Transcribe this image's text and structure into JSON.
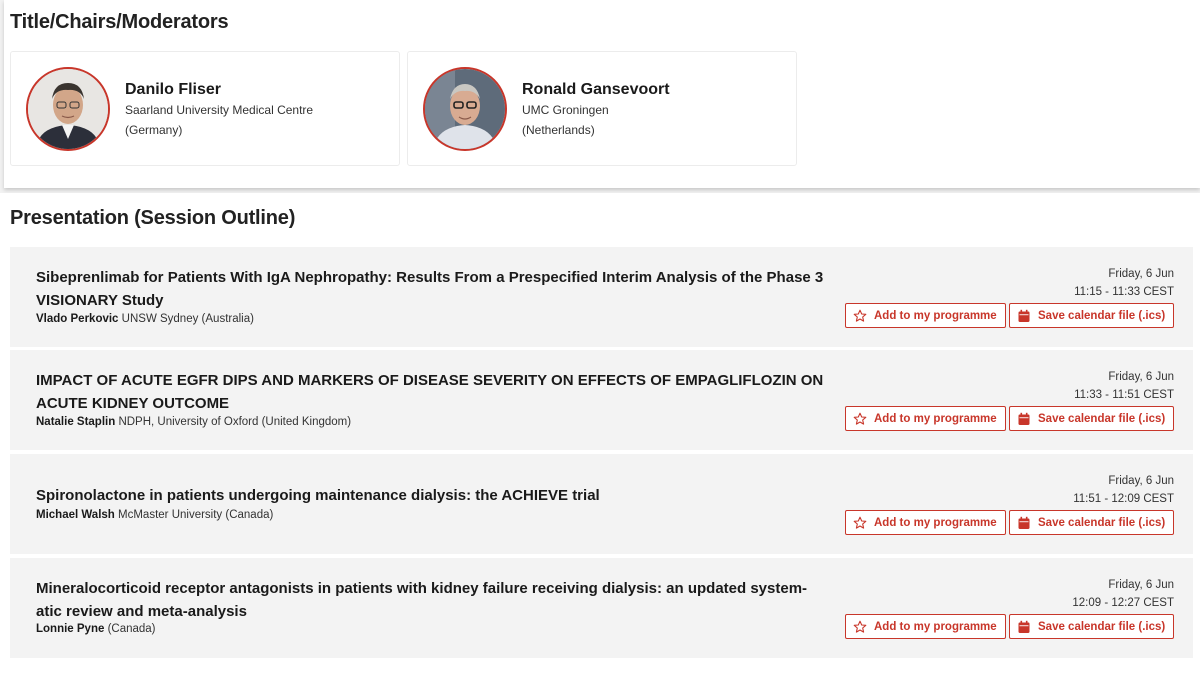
{
  "chairs_section": {
    "title": "Title/Chairs/Moderators",
    "chairs": [
      {
        "name": "Danilo Fliser",
        "org": "Saarland University Medical Centre",
        "country": "(Germany)"
      },
      {
        "name": "Ronald Gansevoort",
        "org": "UMC Groningen",
        "country": "(Netherlands)"
      }
    ]
  },
  "presentation_section": {
    "title": "Presentation (Session Outline)",
    "add_label": "Add to my programme",
    "ics_label": "Save calendar file (.ics)",
    "items": [
      {
        "title_line1": "Sibeprenlimab for Patients With IgA Nephropathy: Results From a Prespecified Interim Analysis of the Phase 3",
        "title_line2": "VISIONARY Study",
        "speaker": "Vlado Perkovic",
        "affiliation": " UNSW Sydney (Australia)",
        "date": "Friday, 6 Jun",
        "time": "11:15 - 11:33 CEST"
      },
      {
        "title_line1": "IMPACT OF ACUTE EGFR DIPS AND MARKERS OF DISEASE SEVERITY ON EFFECTS OF EMPAGLIFLOZIN ON",
        "title_line2": "ACUTE KIDNEY OUTCOME",
        "speaker": "Natalie Staplin",
        "affiliation": " NDPH, University of Oxford (United Kingdom)",
        "date": "Friday, 6 Jun",
        "time": "11:33 - 11:51 CEST"
      },
      {
        "title_line1": "Spironolactone in patients undergoing maintenance dialysis: the ACHIEVE trial",
        "title_line2": "",
        "speaker": "Michael Walsh",
        "affiliation": " McMaster University (Canada)",
        "date": "Friday, 6 Jun",
        "time": "11:51 - 12:09 CEST"
      },
      {
        "title_line1": "Mineralocorticoid receptor antagonists in patients with kidney failure receiving dialysis: an updated system-",
        "title_line2": "atic review and meta-analysis",
        "speaker": "Lonnie Pyne",
        "affiliation": " (Canada)",
        "date": "Friday, 6 Jun",
        "time": "12:09 - 12:27 CEST"
      }
    ]
  },
  "icons": {
    "add": "star-icon",
    "ics": "calendar-icon"
  },
  "colors": {
    "accent": "#c8362a"
  }
}
